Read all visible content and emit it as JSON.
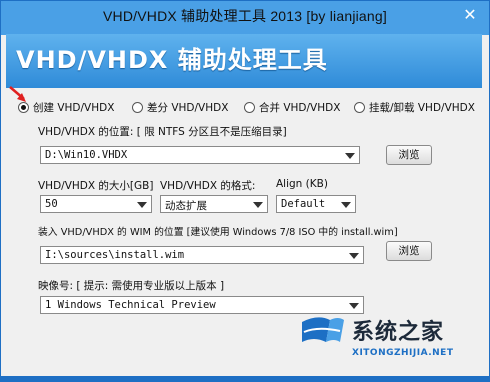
{
  "window": {
    "title": "VHD/VHDX 辅助处理工具 2013 [by lianjiang]",
    "close_symbol": "✕"
  },
  "banner": {
    "title": "VHD/VHDX 辅助处理工具"
  },
  "modes": [
    {
      "label": "创建 VHD/VHDX",
      "checked": true
    },
    {
      "label": "差分 VHD/VHDX",
      "checked": false
    },
    {
      "label": "合并 VHD/VHDX",
      "checked": false
    },
    {
      "label": "挂载/卸载 VHD/VHDX",
      "checked": false
    }
  ],
  "vhd_location": {
    "label": "VHD/VHDX 的位置: [ 限 NTFS 分区且不是压缩目录]",
    "value": "D:\\Win10.VHDX",
    "browse_label": "浏览"
  },
  "size": {
    "label": "VHD/VHDX 的大小[GB]",
    "value": "50"
  },
  "format": {
    "label": "VHD/VHDX 的格式:",
    "value": "动态扩展"
  },
  "align": {
    "label": "Align (KB)",
    "value": "Default"
  },
  "wim": {
    "label": "装入 VHD/VHDX  的 WIM 的位置 [建议使用 Windows 7/8 ISO 中的 install.wim]",
    "value": "I:\\sources\\install.wim",
    "browse_label": "浏览"
  },
  "image": {
    "label": "映像号: [ 提示: 需使用专业版以上版本 ]",
    "value": "1   Windows Technical Preview"
  },
  "watermark": {
    "text": "系统之家",
    "url": "XITONGZHIJIA.NET"
  },
  "colors": {
    "titlebar": "#4aa0e6",
    "banner": "#2f8bd8",
    "pointer_arrow": "#e02020"
  }
}
